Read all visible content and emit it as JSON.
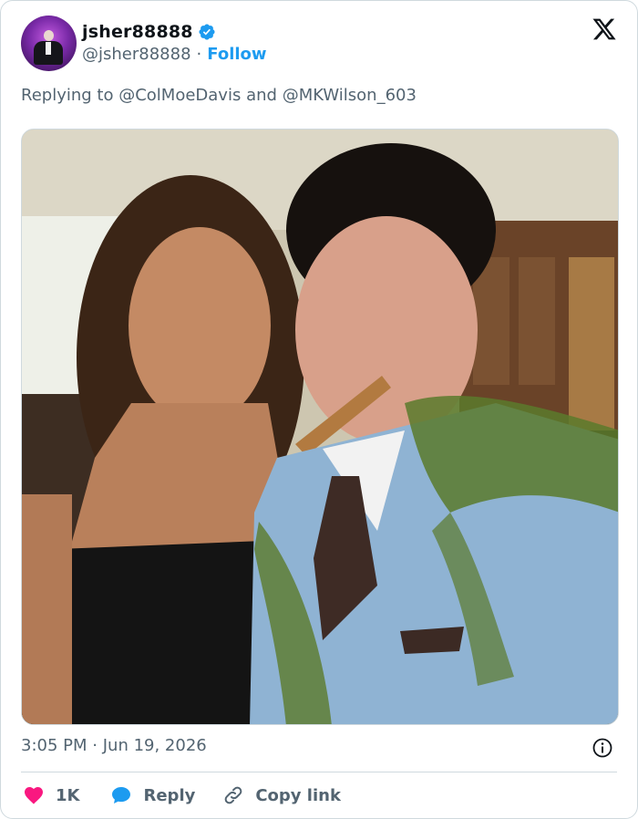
{
  "author": {
    "display_name": "jsher88888",
    "handle": "@jsher88888",
    "separator": "·",
    "follow_label": "Follow",
    "verified": true
  },
  "reply": {
    "prefix": "Replying to",
    "mention_1": "@ColMoeDavis",
    "conjunction": "and",
    "mention_2": "@MKWilson_603"
  },
  "meta": {
    "time": "3:05 PM",
    "separator": "·",
    "date": "Jun 19, 2026"
  },
  "actions": {
    "like_count": "1K",
    "reply_label": "Reply",
    "copy_label": "Copy link"
  },
  "icons": {
    "brand": "x-logo-icon",
    "verified": "verified-badge-icon",
    "info": "info-icon",
    "like": "heart-icon",
    "reply": "speech-bubble-icon",
    "copy": "link-icon"
  },
  "colors": {
    "accent": "#1d9bf0",
    "secondary_text": "#536471",
    "like": "#f91880",
    "border": "#cfd9de"
  }
}
